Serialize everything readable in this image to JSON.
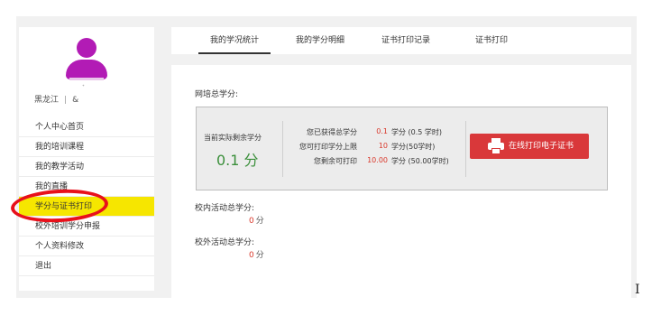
{
  "sidebar": {
    "user": {
      "region": "黑龙江",
      "separator": "|",
      "name": "&"
    },
    "items": [
      {
        "label": "个人中心首页"
      },
      {
        "label": "我的培训课程"
      },
      {
        "label": "我的教学活动"
      },
      {
        "label": "我的直播"
      },
      {
        "label": "学分与证书打印"
      },
      {
        "label": "校外培训学分申报"
      },
      {
        "label": "个人资料修改"
      },
      {
        "label": "退出"
      }
    ],
    "active_index": 4
  },
  "tabs": [
    {
      "label": "我的学况统计"
    },
    {
      "label": "我的学分明细"
    },
    {
      "label": "证书打印记录"
    },
    {
      "label": "证书打印"
    }
  ],
  "main": {
    "total_label": "网培总学分:",
    "stats": {
      "remain_label": "当前实际剩余学分",
      "remain_value": "0.1 分",
      "rows": [
        {
          "label": "您已获得总学分",
          "value": "0.1",
          "unit": "学分 (0.5 学时)"
        },
        {
          "label": "您可打印学分上限",
          "value": "10",
          "unit": "学分(50学时)"
        },
        {
          "label": "您剩余可打印",
          "value": "10.00",
          "unit": "学分 (50.00学时)"
        }
      ],
      "print_button": "在线打印电子证书"
    },
    "school_label": "校内活动总学分:",
    "school_value": "0",
    "outside_label": "校外活动总学分:",
    "outside_value": "0",
    "unit": "分"
  },
  "colors": {
    "active_menu": "#f6e600",
    "avatar": "#b21bb5",
    "print_button": "#d9383a",
    "remain_value": "#3a8f3a",
    "annotation_circle": "#e8101b"
  }
}
